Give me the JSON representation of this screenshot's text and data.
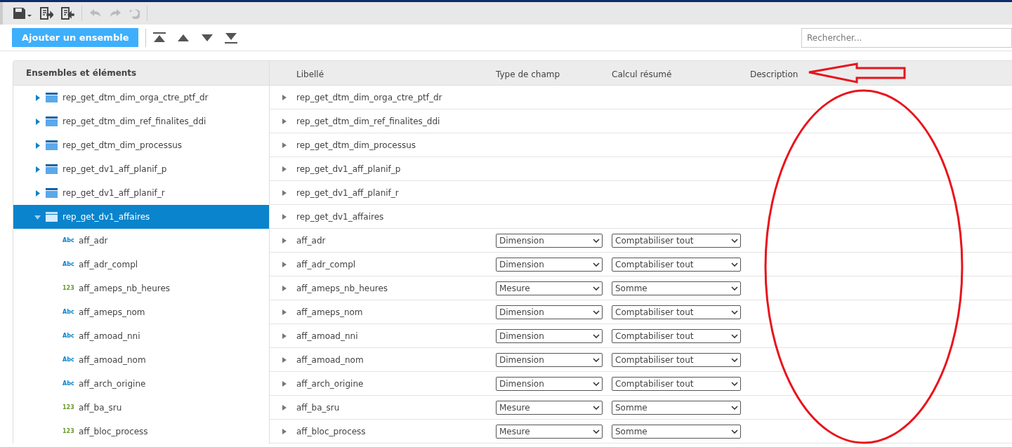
{
  "toolbar": {
    "undo_disabled": true,
    "redo_disabled": true,
    "revert_disabled": true
  },
  "actions": {
    "add_button": "Ajouter un ensemble"
  },
  "search": {
    "placeholder": "Rechercher..."
  },
  "tree": {
    "header": "Ensembles et éléments",
    "items": [
      {
        "label": "rep_get_dtm_dim_orga_ctre_ptf_dr",
        "expanded": false,
        "selected": false
      },
      {
        "label": "rep_get_dtm_dim_ref_finalites_ddi",
        "expanded": false,
        "selected": false
      },
      {
        "label": "rep_get_dtm_dim_processus",
        "expanded": false,
        "selected": false
      },
      {
        "label": "rep_get_dv1_aff_planif_p",
        "expanded": false,
        "selected": false
      },
      {
        "label": "rep_get_dv1_aff_planif_r",
        "expanded": false,
        "selected": false
      },
      {
        "label": "rep_get_dv1_affaires",
        "expanded": true,
        "selected": true,
        "children": [
          {
            "kind": "text",
            "badge": "Abc",
            "label": "aff_adr",
            "selected": false
          },
          {
            "kind": "text",
            "badge": "Abc",
            "label": "aff_adr_compl",
            "selected": false
          },
          {
            "kind": "number",
            "badge": "123",
            "label": "aff_ameps_nb_heures",
            "selected": false
          },
          {
            "kind": "text",
            "badge": "Abc",
            "label": "aff_ameps_nom",
            "selected": false
          },
          {
            "kind": "text",
            "badge": "Abc",
            "label": "aff_amoad_nni",
            "selected": false
          },
          {
            "kind": "text",
            "badge": "Abc",
            "label": "aff_amoad_nom",
            "selected": false
          },
          {
            "kind": "text",
            "badge": "Abc",
            "label": "aff_arch_origine",
            "selected": false
          },
          {
            "kind": "number",
            "badge": "123",
            "label": "aff_ba_sru",
            "selected": false
          },
          {
            "kind": "number",
            "badge": "123",
            "label": "aff_bloc_process",
            "selected": false
          }
        ]
      }
    ]
  },
  "table": {
    "columns": [
      "Libellé",
      "Type de champ",
      "Calcul résumé",
      "Description"
    ],
    "rows": [
      {
        "label": "rep_get_dtm_dim_orga_ctre_ptf_dr"
      },
      {
        "label": "rep_get_dtm_dim_ref_finalites_ddi"
      },
      {
        "label": "rep_get_dtm_dim_processus"
      },
      {
        "label": "rep_get_dv1_aff_planif_p"
      },
      {
        "label": "rep_get_dv1_aff_planif_r"
      },
      {
        "label": "rep_get_dv1_affaires"
      },
      {
        "label": "aff_adr",
        "field_type": "Dimension",
        "summary": "Comptabiliser tout"
      },
      {
        "label": "aff_adr_compl",
        "field_type": "Dimension",
        "summary": "Comptabiliser tout"
      },
      {
        "label": "aff_ameps_nb_heures",
        "field_type": "Mesure",
        "summary": "Somme"
      },
      {
        "label": "aff_ameps_nom",
        "field_type": "Dimension",
        "summary": "Comptabiliser tout"
      },
      {
        "label": "aff_amoad_nni",
        "field_type": "Dimension",
        "summary": "Comptabiliser tout"
      },
      {
        "label": "aff_amoad_nom",
        "field_type": "Dimension",
        "summary": "Comptabiliser tout"
      },
      {
        "label": "aff_arch_origine",
        "field_type": "Dimension",
        "summary": "Comptabiliser tout"
      },
      {
        "label": "aff_ba_sru",
        "field_type": "Mesure",
        "summary": "Somme"
      },
      {
        "label": "aff_bloc_process",
        "field_type": "Mesure",
        "summary": "Somme"
      }
    ]
  }
}
